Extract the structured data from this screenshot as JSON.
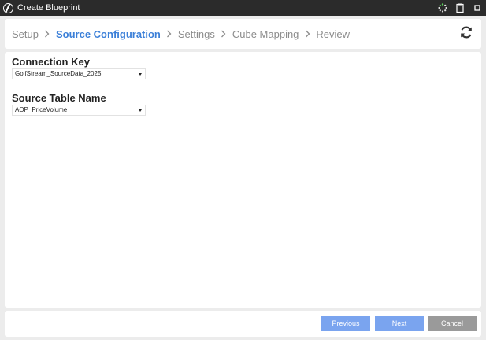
{
  "window": {
    "title": "Create Blueprint",
    "icons": [
      "loading-spinner-icon",
      "clipboard-icon",
      "maximize-icon"
    ]
  },
  "wizard": {
    "steps": [
      {
        "label": "Setup",
        "active": false
      },
      {
        "label": "Source Configuration",
        "active": true
      },
      {
        "label": "Settings",
        "active": false
      },
      {
        "label": "Cube Mapping",
        "active": false
      },
      {
        "label": "Review",
        "active": false
      }
    ],
    "refresh_icon": "refresh-icon",
    "active_color": "#3b7fd8"
  },
  "form": {
    "connection_key": {
      "label": "Connection Key",
      "value": "GolfStream_SourceData_2025"
    },
    "source_table": {
      "label": "Source Table Name",
      "value": "AOP_PriceVolume"
    }
  },
  "footer": {
    "previous_label": "Previous",
    "next_label": "Next",
    "cancel_label": "Cancel"
  }
}
